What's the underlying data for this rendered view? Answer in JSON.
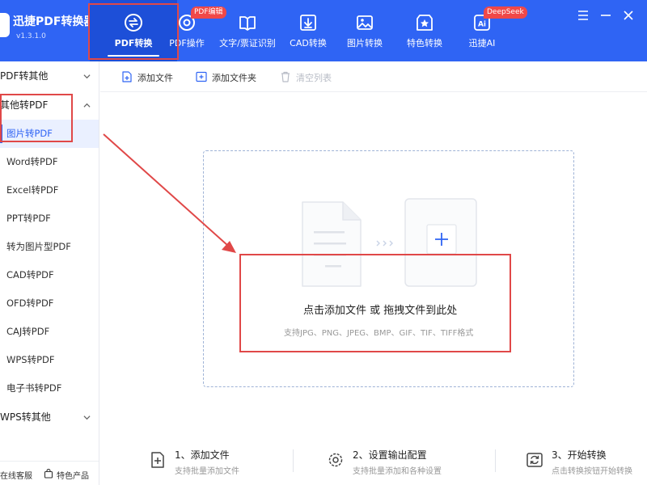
{
  "app": {
    "name": "迅捷PDF转换器",
    "version": "v1.3.1.0",
    "accent": "#2f64f4",
    "annotation_color": "#e04848"
  },
  "nav": {
    "tabs": [
      {
        "label": "PDF转换",
        "icon": "convert-icon",
        "active": true
      },
      {
        "label": "PDF操作",
        "icon": "gear-icon",
        "badge": "PDF编辑"
      },
      {
        "label": "文字/票证识别",
        "icon": "book-icon"
      },
      {
        "label": "CAD转换",
        "icon": "download-box-icon"
      },
      {
        "label": "图片转换",
        "icon": "image-icon"
      },
      {
        "label": "特色转换",
        "icon": "star-icon"
      },
      {
        "label": "迅捷AI",
        "icon": "ai-icon",
        "badge": "DeepSeek"
      }
    ]
  },
  "window_controls": [
    "menu-icon",
    "minimize-icon",
    "close-icon"
  ],
  "sidebar": {
    "groups": [
      {
        "label": "PDF转其他",
        "expanded": false
      },
      {
        "label": "其他转PDF",
        "expanded": true
      },
      {
        "label": "WPS转其他",
        "expanded": false
      }
    ],
    "items": [
      {
        "label": "图片转PDF",
        "active": true
      },
      {
        "label": "Word转PDF"
      },
      {
        "label": "Excel转PDF"
      },
      {
        "label": "PPT转PDF"
      },
      {
        "label": "转为图片型PDF"
      },
      {
        "label": "CAD转PDF"
      },
      {
        "label": "OFD转PDF"
      },
      {
        "label": "CAJ转PDF"
      },
      {
        "label": "WPS转PDF"
      },
      {
        "label": "电子书转PDF"
      }
    ],
    "footer": {
      "service": "在线客服",
      "featured": "特色产品"
    }
  },
  "toolbar": {
    "add_file": "添加文件",
    "add_folder": "添加文件夹",
    "clear_list": "清空列表"
  },
  "dropzone": {
    "title": "点击添加文件 或 拖拽文件到此处",
    "hint": "支持JPG、PNG、JPEG、BMP、GIF、TIF、TIFF格式"
  },
  "steps": [
    {
      "title": "1、添加文件",
      "desc": "支持批量添加文件",
      "icon": "add-file-icon"
    },
    {
      "title": "2、设置输出配置",
      "desc": "支持批量添加和各种设置",
      "icon": "settings-icon"
    },
    {
      "title": "3、开始转换",
      "desc": "点击转换按钮开始转换",
      "icon": "convert-refresh-icon"
    }
  ]
}
